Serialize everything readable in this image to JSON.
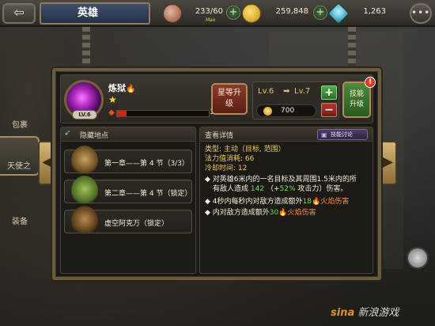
{
  "topbar": {
    "back_label": "⇦",
    "title": "英雄",
    "stamina": "233/60",
    "stamina_sub": "Max",
    "gold": "259,848",
    "gems": "1,263",
    "plus_label": "+",
    "chat_label": "•••"
  },
  "sidebar": {
    "items": [
      {
        "label": "包裹"
      },
      {
        "label": "天使之"
      },
      {
        "label": "装备"
      }
    ]
  },
  "skill": {
    "name": "炼狱",
    "fire_mark": "🔥",
    "star": "★",
    "level_badge": "LV.6",
    "xp_text": "1/10",
    "xp_fraction": 0.1,
    "star_upgrade_label": "星等升级",
    "level_from": "Lv.6",
    "level_arrow": "➡",
    "level_to": "Lv.7",
    "cost": "700",
    "plus_label": "+",
    "minus_label": "−",
    "skill_upgrade_label": "技能升级",
    "alert_mark": "!"
  },
  "locations": {
    "header": "隐藏地点",
    "items": [
      {
        "text": "第一章——第 4 节（3/3）",
        "color": "#9a7a3a"
      },
      {
        "text": "第二章——第 4 节（锁定）",
        "color": "#6a8a3a"
      },
      {
        "text": "虚空阿克万（锁定）",
        "color": "#7a5a2a"
      }
    ]
  },
  "details": {
    "header": "查看详情",
    "discuss_label": "技能讨论",
    "type_label": "类型:",
    "type_value": "主动（目标, 范围）",
    "mana_label": "法力值消耗:",
    "mana_value": "66",
    "cooldown_label": "冷却时间:",
    "cooldown_value": "12",
    "desc_line1": "◆  对英雄6米内的一名目标及其周围1.5米内的所",
    "desc_line2_pre": "有敌人造成",
    "desc_dmg": "142",
    "desc_bonus_pre": "（+",
    "desc_bonus": "52%",
    "desc_bonus_post": "攻击力）伤害。",
    "fire_line1_pre": "◆  4秒内每秒内对敌方造成额外",
    "fire_line1_val": "18",
    "fire_line1_post": "火焰伤害",
    "fire_line2_pre": "◆  内对敌方造成额外",
    "fire_line2_val": "30",
    "fire_line2_post": "火焰伤害"
  },
  "watermark": {
    "brand": "sina",
    "text": "新浪游戏"
  },
  "colors": {
    "accent_gold": "#e8c470",
    "positive_green": "#6ee04a",
    "fire_orange": "#ff8a26",
    "panel_border": "#6a5a3e"
  }
}
